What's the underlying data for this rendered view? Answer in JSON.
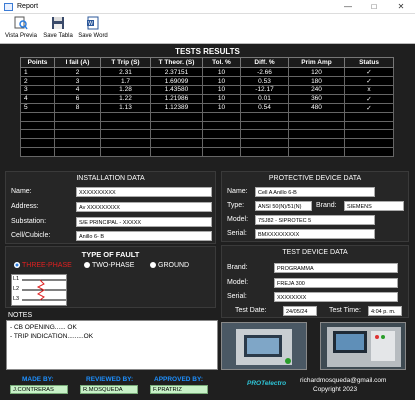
{
  "window": {
    "title": "Report"
  },
  "toolbar": {
    "preview": "Vista Previa",
    "save_table": "Save Tabla",
    "save_word": "Save Word"
  },
  "results": {
    "title": "TESTS RESULTS",
    "headers": [
      "Points",
      "I fail (A)",
      "T Trip (S)",
      "T Theor. (S)",
      "Tol. %",
      "Diff. %",
      "Prim Amp",
      "Status"
    ],
    "rows": [
      [
        "1",
        "2",
        "2.31",
        "2.37151",
        "10",
        "-2.66",
        "120",
        "✓"
      ],
      [
        "2",
        "3",
        "1.7",
        "1.69099",
        "10",
        "0.53",
        "180",
        "✓"
      ],
      [
        "3",
        "4",
        "1.28",
        "1.43580",
        "10",
        "-12.17",
        "240",
        "x"
      ],
      [
        "4",
        "6",
        "1.22",
        "1.21986",
        "10",
        "0.01",
        "360",
        "✓"
      ],
      [
        "5",
        "8",
        "1.13",
        "1.12389",
        "10",
        "0.54",
        "480",
        "✓"
      ]
    ]
  },
  "installation": {
    "title": "INSTALLATION DATA",
    "name_label": "Name:",
    "name": "XXXXXXXXXX",
    "address_label": "Address:",
    "address": "Av XXXXXXXXX",
    "substation_label": "Substation:",
    "substation": "S/E PRINCIPAL - XXXXX",
    "cell_label": "Cell/Cubicle:",
    "cell": "Anillo 6- B"
  },
  "fault": {
    "title": "TYPE OF FAULT",
    "three_phase": "THREE-PHASE",
    "two_phase": "TWO-PHASE",
    "ground": "GROUND",
    "l1": "L1",
    "l2": "L2",
    "l3": "L3",
    "selected_color": "#e02020"
  },
  "protective": {
    "title": "PROTECTIVE DEVICE DATA",
    "name_label": "Name:",
    "name": "Cell A Anillo 6-B",
    "type_label": "Type:",
    "type": "ANSI 50(N)/51(N)",
    "brand_label": "Brand:",
    "brand": "SIEMENS",
    "model_label": "Model:",
    "model": "7SJ82 - SIPROTEC 5",
    "serial_label": "Serial:",
    "serial": "BMXXXXXXXXX"
  },
  "test_device": {
    "title": "TEST DEVICE DATA",
    "brand_label": "Brand:",
    "brand": "PROGRAMMA",
    "model_label": "Model:",
    "model": "FREJA 300",
    "serial_label": "Serial:",
    "serial": "XXXXXXXX",
    "date_label": "Test Date:",
    "date": "24/05/24",
    "time_label": "Test Time:",
    "time": "4:04 p. m."
  },
  "notes": {
    "title": "NOTES",
    "line1": "- CB OPENING...... OK",
    "line2": "- TRIP INDICATION.........OK"
  },
  "footer": {
    "made_by_label": "MADE BY:",
    "made_by": "J.CONTRERAS",
    "reviewed_label": "REVIEWED BY:",
    "reviewed": "R.MOSQUEDA",
    "approved_label": "APPROVED BY:",
    "approved": "F.PRATRIZ",
    "logo_text": "PROTelectro",
    "email": "richardmosqueda@gmail.com",
    "copyright": "Copyright  2023"
  },
  "colors": {
    "accent": "#1e90ff",
    "fault_selected": "#e02020",
    "signature_bg": "#c8f2c8"
  }
}
